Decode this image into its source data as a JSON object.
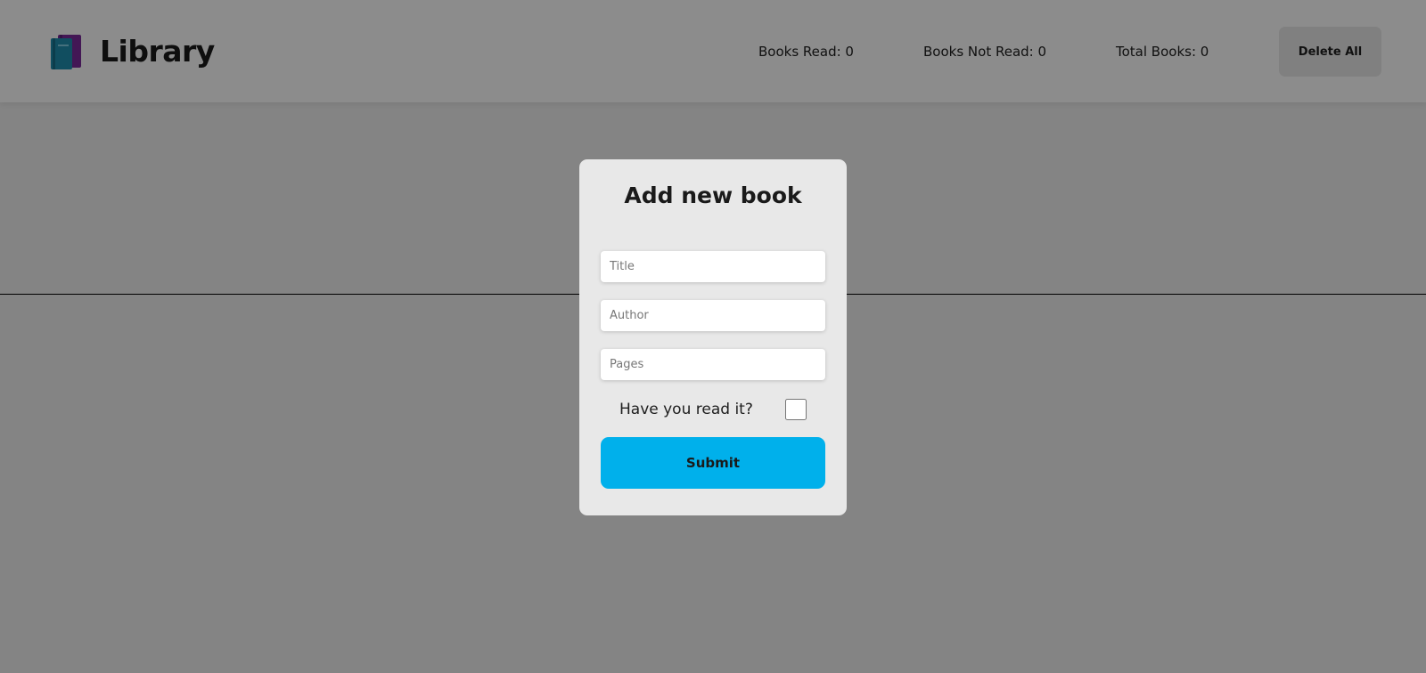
{
  "header": {
    "brand_title": "Library",
    "logo_icon": "books-icon",
    "stats": {
      "books_read": "Books Read: 0",
      "books_not_read": "Books Not Read: 0",
      "total_books": "Total Books: 0"
    },
    "delete_all_label": "Delete All"
  },
  "modal": {
    "title": "Add new book",
    "title_placeholder": "Title",
    "author_placeholder": "Author",
    "pages_placeholder": "Pages",
    "read_label": "Have you read it?",
    "read_checked": false,
    "submit_label": "Submit"
  },
  "colors": {
    "accent": "#00b0eb",
    "logo_purple": "#7b2a9c",
    "logo_teal": "#1f8fb0",
    "overlay": "rgba(0,0,0,0.45)"
  }
}
